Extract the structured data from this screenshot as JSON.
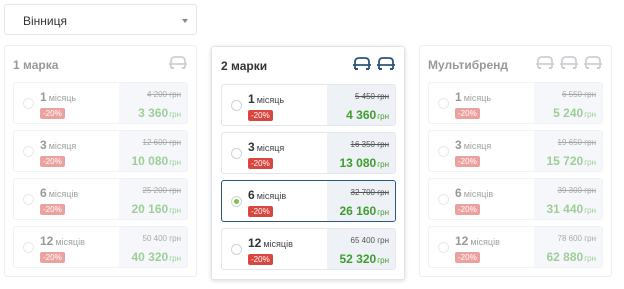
{
  "city_select": {
    "value": "Вінниця"
  },
  "cards": [
    {
      "title": "1 марка",
      "icon_count": 1,
      "dimmed": true,
      "plans": [
        {
          "num": "1",
          "unit": "місяць",
          "discount": "-20%",
          "old_price": "4 200 грн",
          "old_strike": true,
          "new_amount": "3 360",
          "currency": "грн",
          "selected": false
        },
        {
          "num": "3",
          "unit": "місяця",
          "discount": "-20%",
          "old_price": "12 600 грн",
          "old_strike": true,
          "new_amount": "10 080",
          "currency": "грн",
          "selected": false
        },
        {
          "num": "6",
          "unit": "місяців",
          "discount": "-20%",
          "old_price": "25 200 грн",
          "old_strike": true,
          "new_amount": "20 160",
          "currency": "грн",
          "selected": false
        },
        {
          "num": "12",
          "unit": "місяців",
          "discount": "-20%",
          "old_price": "50 400 грн",
          "old_strike": false,
          "new_amount": "40 320",
          "currency": "грн",
          "selected": false
        }
      ]
    },
    {
      "title": "2 марки",
      "icon_count": 2,
      "dimmed": false,
      "plans": [
        {
          "num": "1",
          "unit": "місяць",
          "discount": "-20%",
          "old_price": "5 450 грн",
          "old_strike": true,
          "new_amount": "4 360",
          "currency": "грн",
          "selected": false
        },
        {
          "num": "3",
          "unit": "місяця",
          "discount": "-20%",
          "old_price": "16 350 грн",
          "old_strike": true,
          "new_amount": "13 080",
          "currency": "грн",
          "selected": false
        },
        {
          "num": "6",
          "unit": "місяців",
          "discount": "-20%",
          "old_price": "32 700 грн",
          "old_strike": true,
          "new_amount": "26 160",
          "currency": "грн",
          "selected": true
        },
        {
          "num": "12",
          "unit": "місяців",
          "discount": "-20%",
          "old_price": "65 400 грн",
          "old_strike": false,
          "new_amount": "52 320",
          "currency": "грн",
          "selected": false
        }
      ]
    },
    {
      "title": "Мультибренд",
      "icon_count": 3,
      "dimmed": true,
      "plans": [
        {
          "num": "1",
          "unit": "місяць",
          "discount": "-20%",
          "old_price": "6 550 грн",
          "old_strike": true,
          "new_amount": "5 240",
          "currency": "грн",
          "selected": false
        },
        {
          "num": "3",
          "unit": "місяця",
          "discount": "-20%",
          "old_price": "19 650 грн",
          "old_strike": true,
          "new_amount": "15 720",
          "currency": "грн",
          "selected": false
        },
        {
          "num": "6",
          "unit": "місяців",
          "discount": "-20%",
          "old_price": "39 300 грн",
          "old_strike": true,
          "new_amount": "31 440",
          "currency": "грн",
          "selected": false
        },
        {
          "num": "12",
          "unit": "місяців",
          "discount": "-20%",
          "old_price": "78 600 грн",
          "old_strike": false,
          "new_amount": "62 880",
          "currency": "грн",
          "selected": false
        }
      ]
    }
  ],
  "colors": {
    "accent_navy": "#2b557a",
    "price_green": "#3f9e2f",
    "discount_red": "#d8473f",
    "radio_selected": "#7cc242"
  }
}
